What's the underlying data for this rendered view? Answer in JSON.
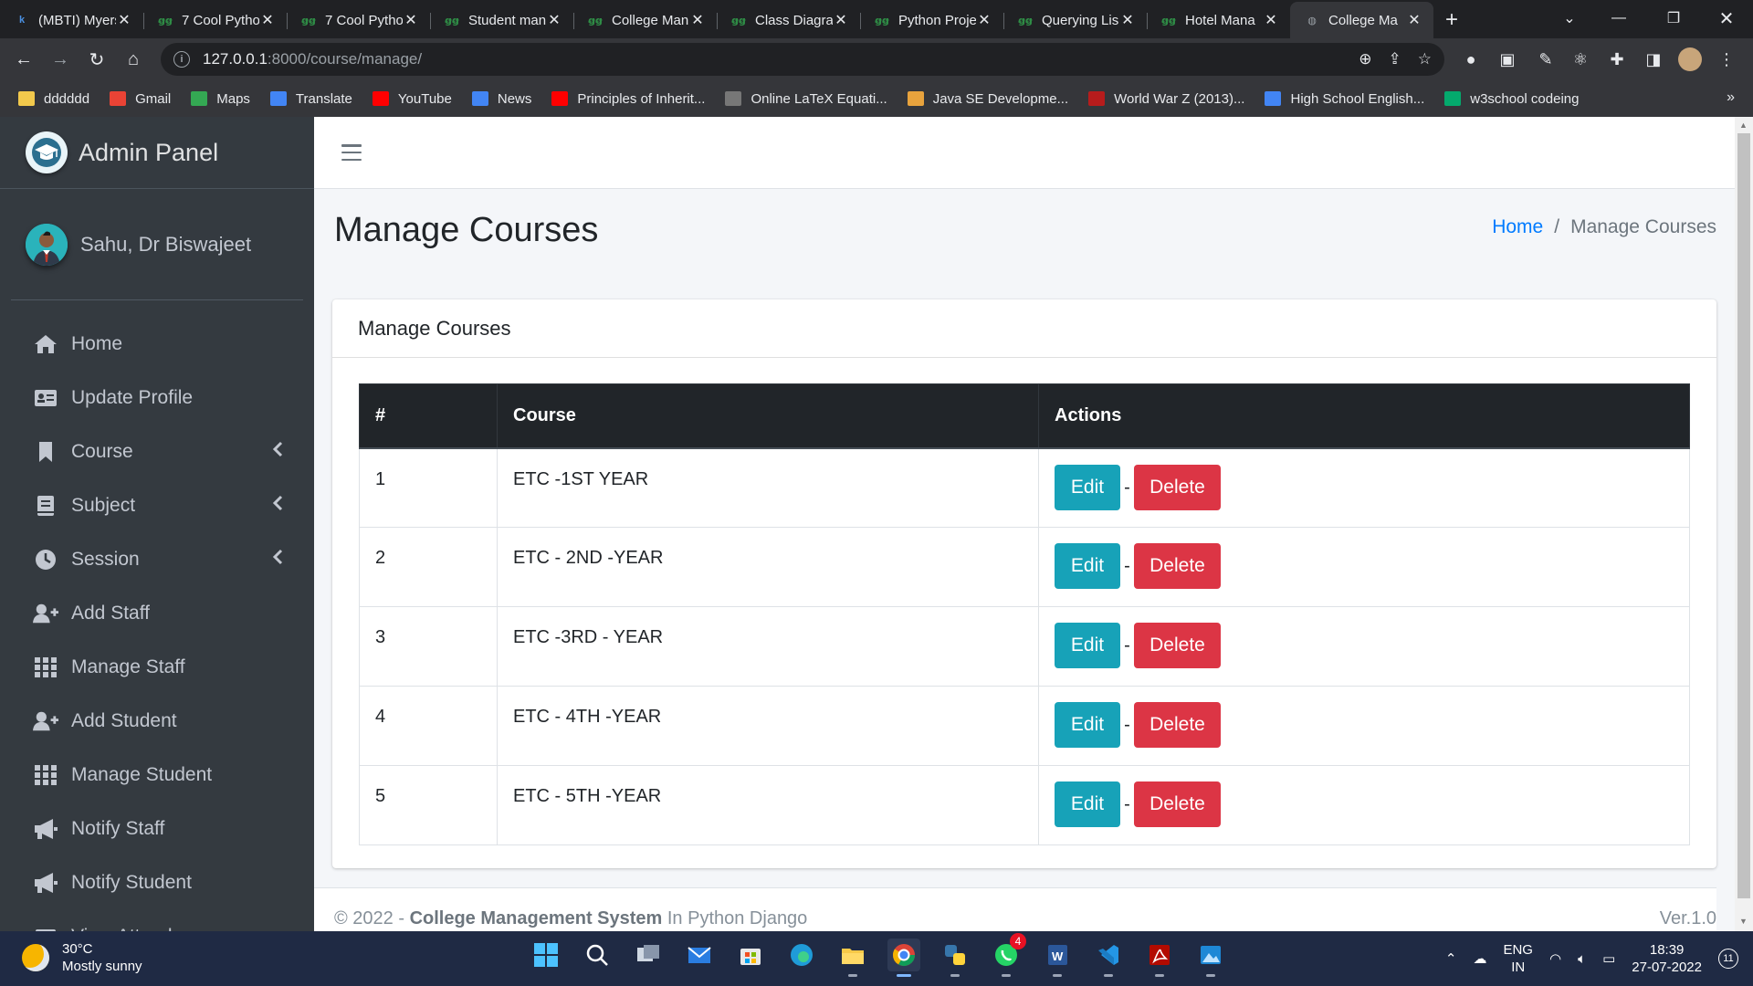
{
  "browser": {
    "tabs": [
      {
        "title": "(MBTI) Myers",
        "favicon": "k-icon",
        "fav_text": "k",
        "fav_color": "#4a90e2"
      },
      {
        "title": "7 Cool Pytho",
        "favicon": "gfg-icon",
        "fav_text": "ꞡꞡ",
        "fav_color": "#2f8d46"
      },
      {
        "title": "7 Cool Pytho",
        "favicon": "gfg-icon",
        "fav_text": "ꞡꞡ",
        "fav_color": "#2f8d46"
      },
      {
        "title": "Student man",
        "favicon": "gfg-icon",
        "fav_text": "ꞡꞡ",
        "fav_color": "#2f8d46"
      },
      {
        "title": "College Man",
        "favicon": "gfg-icon",
        "fav_text": "ꞡꞡ",
        "fav_color": "#2f8d46"
      },
      {
        "title": "Class Diagra",
        "favicon": "gfg-icon",
        "fav_text": "ꞡꞡ",
        "fav_color": "#2f8d46"
      },
      {
        "title": "Python Proje",
        "favicon": "gfg-icon",
        "fav_text": "ꞡꞡ",
        "fav_color": "#2f8d46"
      },
      {
        "title": "Querying Lis",
        "favicon": "gfg-icon",
        "fav_text": "ꞡꞡ",
        "fav_color": "#2f8d46"
      },
      {
        "title": "Hotel Mana",
        "favicon": "gfg-icon",
        "fav_text": "ꞡꞡ",
        "fav_color": "#2f8d46"
      },
      {
        "title": "College Ma",
        "favicon": "globe-icon",
        "fav_text": "◍",
        "fav_color": "#9aa0a6",
        "active": true
      }
    ],
    "url_host": "127.0.0.1",
    "url_rest": ":8000/course/manage/",
    "bookmarks": [
      {
        "label": "dddddd",
        "icon": "folder-icon",
        "color": "#f2c94c"
      },
      {
        "label": "Gmail",
        "icon": "gmail-icon",
        "color": "#ea4335"
      },
      {
        "label": "Maps",
        "icon": "maps-icon",
        "color": "#34a853"
      },
      {
        "label": "Translate",
        "icon": "translate-icon",
        "color": "#4285f4"
      },
      {
        "label": "YouTube",
        "icon": "youtube-icon",
        "color": "#ff0000"
      },
      {
        "label": "News",
        "icon": "news-icon",
        "color": "#4285f4"
      },
      {
        "label": "Principles of Inherit...",
        "icon": "youtube-icon",
        "color": "#ff0000"
      },
      {
        "label": "Online LaTeX Equati...",
        "icon": "gear-icon",
        "color": "#777777"
      },
      {
        "label": "Java SE Developme...",
        "icon": "g-icon",
        "color": "#e8a33d"
      },
      {
        "label": "World War Z (2013)...",
        "icon": "m-icon",
        "color": "#b71c1c"
      },
      {
        "label": "High School English...",
        "icon": "google-icon",
        "color": "#4285f4"
      },
      {
        "label": "w3school codeing",
        "icon": "w3-icon",
        "color": "#04aa6d"
      }
    ]
  },
  "sidebar": {
    "brand": "Admin Panel",
    "user_name": "Sahu, Dr Biswajeet",
    "items": [
      {
        "label": "Home",
        "icon": "home-icon",
        "has_submenu": false
      },
      {
        "label": "Update Profile",
        "icon": "id-card-icon",
        "has_submenu": false
      },
      {
        "label": "Course",
        "icon": "bookmark-icon",
        "has_submenu": true
      },
      {
        "label": "Subject",
        "icon": "book-icon",
        "has_submenu": true
      },
      {
        "label": "Session",
        "icon": "clock-icon",
        "has_submenu": true
      },
      {
        "label": "Add Staff",
        "icon": "user-plus-icon",
        "has_submenu": false
      },
      {
        "label": "Manage Staff",
        "icon": "grid-icon",
        "has_submenu": false
      },
      {
        "label": "Add Student",
        "icon": "user-plus-icon",
        "has_submenu": false
      },
      {
        "label": "Manage Student",
        "icon": "grid-icon",
        "has_submenu": false
      },
      {
        "label": "Notify Staff",
        "icon": "bullhorn-icon",
        "has_submenu": false
      },
      {
        "label": "Notify Student",
        "icon": "bullhorn-icon",
        "has_submenu": false
      },
      {
        "label": "View Attendance",
        "icon": "calendar-icon",
        "has_submenu": false
      }
    ]
  },
  "header": {
    "page_title": "Manage Courses",
    "breadcrumb_home": "Home",
    "breadcrumb_sep": "/",
    "breadcrumb_current": "Manage Courses"
  },
  "card": {
    "title": "Manage Courses",
    "columns": [
      "#",
      "Course",
      "Actions"
    ],
    "edit_label": "Edit",
    "delete_label": "Delete",
    "action_separator": "-",
    "rows": [
      {
        "num": "1",
        "course": "ETC -1ST YEAR"
      },
      {
        "num": "2",
        "course": "ETC - 2ND -YEAR"
      },
      {
        "num": "3",
        "course": "ETC -3RD - YEAR"
      },
      {
        "num": "4",
        "course": "ETC - 4TH -YEAR"
      },
      {
        "num": "5",
        "course": "ETC - 5TH -YEAR"
      }
    ]
  },
  "footer": {
    "prefix": "© 2022 - ",
    "system": "College Management System",
    "suffix": " In Python Django",
    "version": "Ver.1.0"
  },
  "taskbar": {
    "temp": "30°C",
    "weather": "Mostly sunny",
    "lang_top": "ENG",
    "lang_bottom": "IN",
    "time": "18:39",
    "date": "27-07-2022",
    "whatsapp_badge": "4",
    "notif_count": "11"
  },
  "colors": {
    "sidebar_bg": "#343a40",
    "edit_btn": "#17a2b8",
    "delete_btn": "#dc3545",
    "link": "#007bff"
  }
}
